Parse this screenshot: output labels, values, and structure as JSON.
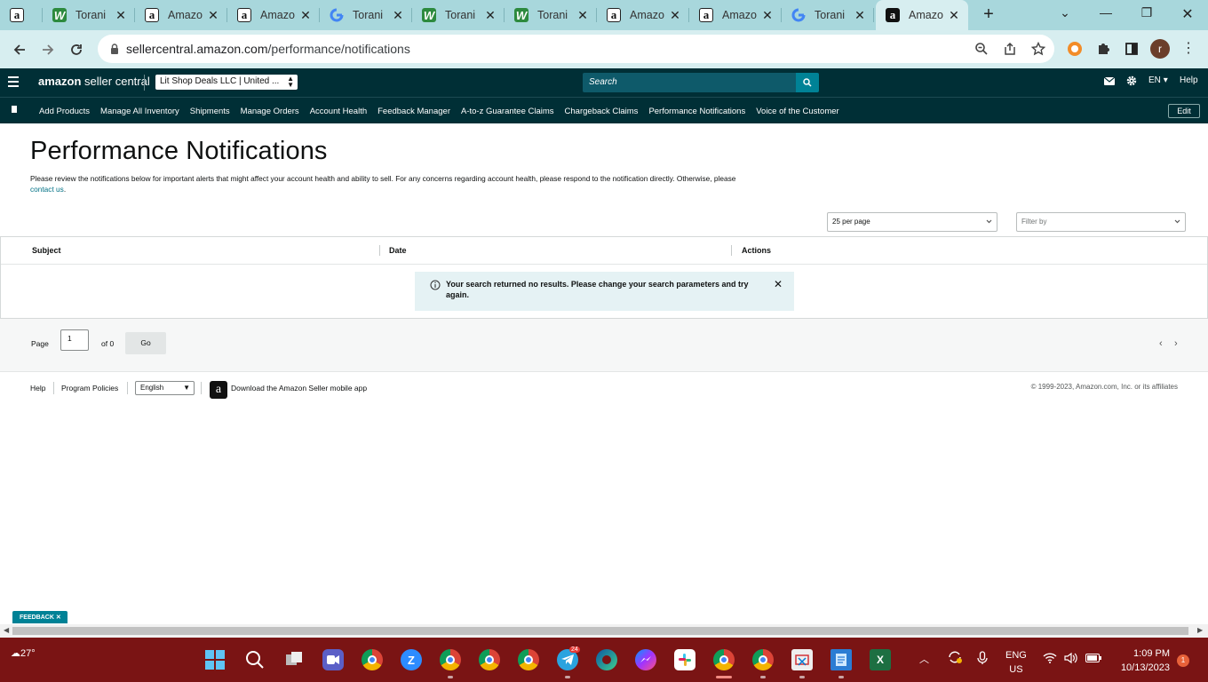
{
  "browser": {
    "tabs": [
      {
        "title": "",
        "favicon": "amazon"
      },
      {
        "title": "Torani",
        "favicon": "torani"
      },
      {
        "title": "Amazo",
        "favicon": "amazon"
      },
      {
        "title": "Amazo",
        "favicon": "amazon"
      },
      {
        "title": "Torani",
        "favicon": "google"
      },
      {
        "title": "Torani",
        "favicon": "torani"
      },
      {
        "title": "Torani",
        "favicon": "torani"
      },
      {
        "title": "Amazo",
        "favicon": "amazon"
      },
      {
        "title": "Amazo",
        "favicon": "amazon"
      },
      {
        "title": "Torani",
        "favicon": "google"
      },
      {
        "title": "Amazo",
        "favicon": "amazon-dark",
        "active": true
      }
    ],
    "url_host": "sellercentral.amazon.com",
    "url_path": "/performance/notifications",
    "profile_initial": "r"
  },
  "header": {
    "logo_brand": "amazon",
    "logo_product": "seller central",
    "account_select": "Lit Shop Deals LLC | United ...",
    "search_placeholder": "Search",
    "language": "EN",
    "help": "Help"
  },
  "nav": {
    "items": [
      "Add Products",
      "Manage All Inventory",
      "Shipments",
      "Manage Orders",
      "Account Health",
      "Feedback Manager",
      "A-to-z Guarantee Claims",
      "Chargeback Claims",
      "Performance Notifications",
      "Voice of the Customer"
    ],
    "edit": "Edit"
  },
  "main": {
    "title": "Performance Notifications",
    "intro": "Please review the notifications below for important alerts that might affect your account health and ability to sell. For any concerns regarding account health, please respond to the notification directly. Otherwise, please",
    "contact_link": "contact us",
    "per_page": "25 per page",
    "filter_placeholder": "Filter by",
    "columns": [
      "Subject",
      "Date",
      "Actions"
    ],
    "no_results": "Your search returned no results. Please change your search parameters and try again."
  },
  "pager": {
    "page_label": "Page",
    "page_value": "1",
    "of_label": "of 0",
    "go_label": "Go"
  },
  "footer": {
    "help": "Help",
    "policies": "Program Policies",
    "language": "English",
    "download": "Download the Amazon Seller mobile app",
    "copyright": "© 1999-2023, Amazon.com, Inc. or its affiliates"
  },
  "feedback_label": "FEEDBACK ✕",
  "taskbar": {
    "weather": "27°",
    "lang_top": "ENG",
    "lang_bottom": "US",
    "time": "1:09 PM",
    "date": "10/13/2023",
    "notifications": "1",
    "telegram_badge": "24"
  },
  "colors": {
    "seller_header": "#002f36",
    "search_button": "#008296",
    "link": "#007185",
    "taskbar": "#7a1414",
    "tabstrip": "#a8d7dc"
  }
}
